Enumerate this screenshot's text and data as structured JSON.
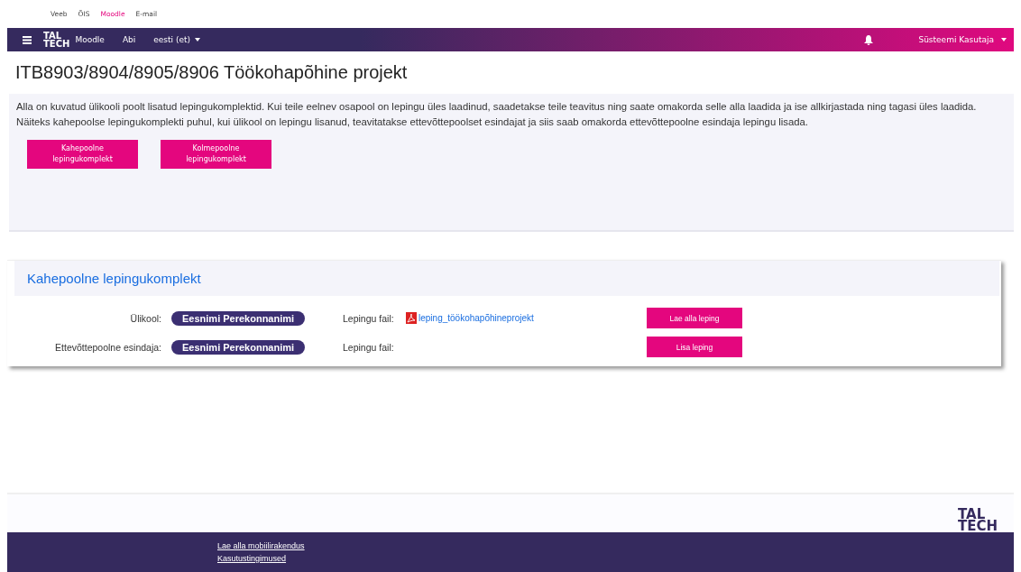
{
  "top_links": [
    {
      "label": "Veeb",
      "selected": false
    },
    {
      "label": "ÕIS",
      "selected": false
    },
    {
      "label": "Moodle",
      "selected": true
    },
    {
      "label": "E-mail",
      "selected": false
    }
  ],
  "navbar": {
    "logo": [
      "TAL",
      "TECH"
    ],
    "items": [
      "Moodle",
      "Abi"
    ],
    "language": "eesti (et)",
    "user": "Süsteemi Kasutaja"
  },
  "page_title": "ITB8903/8904/8905/8906 Töökohapõhine projekt",
  "intro": "Alla on kuvatud ülikooli poolt lisatud lepingukomplektid. Kui teile eelnev osapool on lepingu üles laadinud, saadetakse teile teavitus ning saate omakorda selle alla laadida ja ise allkirjastada ning tagasi üles laadida. Näiteks kahepoolse lepingukomplekti puhul, kui ülikool on lepingu lisanud, teavitatakse ettevõttepoolset esindajat ja siis saab omakorda ettevõttepoolne esindaja lepingu lisada.",
  "set_buttons": [
    "Kahepoolne lepingukomplekt",
    "Kolmepoolne lepingukomplekt"
  ],
  "card": {
    "title": "Kahepoolne lepingukomplekt",
    "rows": [
      {
        "role": "Ülikool:",
        "person": "Eesnimi Perekonnanimi",
        "file_label": "Lepingu fail:",
        "file": "leping_töökohapõhineprojekt",
        "action": "Lae alla leping"
      },
      {
        "role": "Ettevõttepoolne esindaja:",
        "person": "Eesnimi Perekonnanimi",
        "file_label": "Lepingu fail:",
        "action": "Lisa leping"
      }
    ]
  },
  "footer": {
    "logo": [
      "TAL",
      "TECH"
    ],
    "links": [
      "Lae alla mobiilirakendus",
      "Kasutustingimused"
    ]
  }
}
